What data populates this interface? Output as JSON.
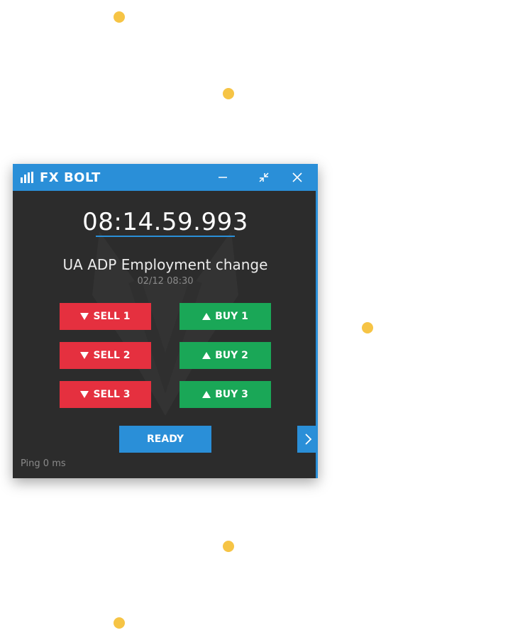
{
  "app": {
    "title": "FX BOLT",
    "colors": {
      "accent": "#2a8fd8",
      "background": "#2c2c2c",
      "sell": "#e5303f",
      "buy": "#1aa757",
      "dots": "#f6c445"
    }
  },
  "titlebar": {
    "logo_icon": "signal-bars-icon",
    "minimize_icon": "minimize-icon",
    "restore_icon": "collapse-icon",
    "close_icon": "close-icon"
  },
  "clock": {
    "time": "08:14.59.993"
  },
  "event": {
    "title": "UA ADP Employment change",
    "date": "02/12 08:30"
  },
  "trade": {
    "sell": [
      {
        "label": "SELL 1"
      },
      {
        "label": "SELL 2"
      },
      {
        "label": "SELL 3"
      }
    ],
    "buy": [
      {
        "label": "BUY 1"
      },
      {
        "label": "BUY 2"
      },
      {
        "label": "BUY 3"
      }
    ]
  },
  "controls": {
    "ready_label": "READY",
    "expand_icon": "chevron-right-icon"
  },
  "status": {
    "ping": "Ping 0 ms"
  }
}
